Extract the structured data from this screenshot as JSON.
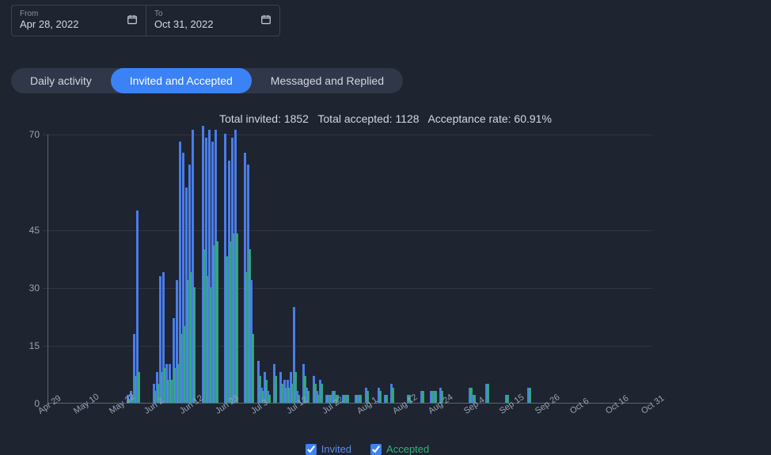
{
  "dateRange": {
    "from": {
      "label": "From",
      "value": "Apr 28, 2022"
    },
    "to": {
      "label": "To",
      "value": "Oct 31, 2022"
    }
  },
  "tabs": [
    {
      "label": "Daily activity",
      "active": false
    },
    {
      "label": "Invited and Accepted",
      "active": true
    },
    {
      "label": "Messaged and Replied",
      "active": false
    }
  ],
  "summary": {
    "total_invited_label": "Total invited:",
    "total_invited": 1852,
    "total_accepted_label": "Total accepted:",
    "total_accepted": 1128,
    "rate_label": "Acceptance rate:",
    "rate": "60.91%"
  },
  "legend": {
    "invited": "Invited",
    "accepted": "Accepted"
  },
  "chart_data": {
    "type": "bar",
    "xlabel": "",
    "ylabel": "",
    "ylim": [
      0,
      70
    ],
    "y_ticks": [
      0,
      15,
      30,
      45,
      70
    ],
    "x_ticks": [
      "Apr 29",
      "May 10",
      "May 22",
      "Jun 2",
      "Jun 12",
      "Jun 23",
      "Jul 3",
      "Jul 12",
      "Jul 22",
      "Aug 1",
      "Aug 12",
      "Aug 24",
      "Sep 4",
      "Sep 15",
      "Sep 26",
      "Oct 6",
      "Oct 16",
      "Oct 31"
    ],
    "categories_start": "2022-04-29",
    "categories_end": "2022-10-31",
    "series": [
      {
        "name": "Invited",
        "color": "#4a7de8",
        "values": [
          0,
          0,
          0,
          0,
          0,
          0,
          0,
          0,
          0,
          0,
          0,
          0,
          0,
          0,
          0,
          0,
          0,
          0,
          0,
          0,
          0,
          0,
          0,
          0,
          2,
          3,
          18,
          50,
          0,
          0,
          0,
          0,
          5,
          8,
          33,
          34,
          10,
          10,
          22,
          32,
          68,
          65,
          56,
          62,
          71,
          0,
          0,
          72,
          69,
          71,
          68,
          71,
          0,
          0,
          70,
          63,
          69,
          71,
          0,
          0,
          65,
          62,
          32,
          0,
          11,
          4,
          8,
          3,
          0,
          10,
          0,
          8,
          6,
          6,
          8,
          25,
          3,
          0,
          10,
          4,
          0,
          7,
          3,
          6,
          0,
          2,
          2,
          3,
          2,
          0,
          2,
          2,
          0,
          0,
          2,
          2,
          0,
          4,
          0,
          0,
          0,
          4,
          0,
          2,
          0,
          5,
          0,
          0,
          0,
          0,
          2,
          0,
          0,
          0,
          3,
          0,
          0,
          3,
          3,
          0,
          4,
          0,
          0,
          0,
          0,
          0,
          0,
          0,
          0,
          4,
          2,
          0,
          0,
          0,
          5,
          0,
          0,
          0,
          0,
          0,
          2,
          0,
          0,
          0,
          0,
          0,
          0,
          4,
          0,
          0,
          0,
          0,
          0,
          0,
          0,
          0,
          0,
          0,
          0,
          0,
          0,
          0,
          0,
          0,
          0,
          0,
          0,
          0,
          0,
          0,
          0,
          0,
          0,
          0,
          0,
          0,
          0,
          0,
          0,
          0,
          0,
          0,
          0,
          0,
          0,
          0
        ]
      },
      {
        "name": "Accepted",
        "color": "#34b27b",
        "values": [
          0,
          0,
          0,
          0,
          0,
          0,
          0,
          0,
          0,
          0,
          0,
          0,
          0,
          0,
          0,
          0,
          0,
          0,
          0,
          0,
          0,
          0,
          0,
          0,
          1,
          2,
          7,
          8,
          0,
          0,
          0,
          0,
          3,
          5,
          8,
          9,
          6,
          6,
          9,
          10,
          18,
          20,
          32,
          34,
          30,
          0,
          0,
          40,
          33,
          30,
          41,
          42,
          0,
          0,
          38,
          42,
          44,
          44,
          0,
          0,
          34,
          40,
          18,
          0,
          7,
          3,
          6,
          2,
          0,
          7,
          0,
          5,
          4,
          4,
          5,
          8,
          2,
          0,
          7,
          3,
          0,
          5,
          2,
          5,
          0,
          2,
          2,
          3,
          2,
          0,
          2,
          2,
          0,
          0,
          2,
          2,
          0,
          3,
          0,
          0,
          0,
          3,
          0,
          2,
          0,
          4,
          0,
          0,
          0,
          0,
          2,
          0,
          0,
          0,
          3,
          0,
          0,
          3,
          3,
          0,
          3,
          0,
          0,
          0,
          0,
          0,
          0,
          0,
          0,
          4,
          2,
          0,
          0,
          0,
          5,
          0,
          0,
          0,
          0,
          0,
          2,
          0,
          0,
          0,
          0,
          0,
          0,
          4,
          0,
          0,
          0,
          0,
          0,
          0,
          0,
          0,
          0,
          0,
          0,
          0,
          0,
          0,
          0,
          0,
          0,
          0,
          0,
          0,
          0,
          0,
          0,
          0,
          0,
          0,
          0,
          0,
          0,
          0,
          0,
          0,
          0,
          0,
          0,
          0,
          0,
          0
        ]
      }
    ]
  }
}
